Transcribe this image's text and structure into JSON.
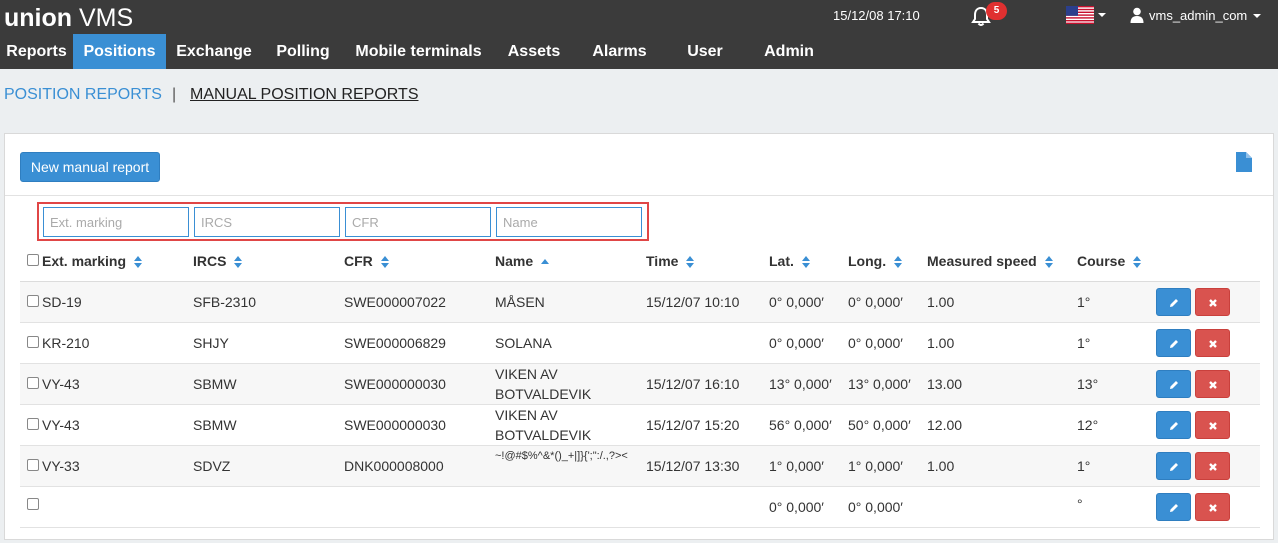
{
  "header": {
    "logo_bold": "union",
    "logo_light": "VMS",
    "datetime": "15/12/08 17:10",
    "notification_count": "5",
    "username": "vms_admin_com"
  },
  "nav": [
    {
      "label": "Reports",
      "active": false
    },
    {
      "label": "Positions",
      "active": true
    },
    {
      "label": "Exchange",
      "active": false
    },
    {
      "label": "Polling",
      "active": false
    },
    {
      "label": "Mobile terminals",
      "active": false
    },
    {
      "label": "Assets",
      "active": false
    },
    {
      "label": "Alarms",
      "active": false
    },
    {
      "label": "User",
      "active": false
    },
    {
      "label": "Admin",
      "active": false
    }
  ],
  "subnav": {
    "position_reports": "POSITION REPORTS",
    "separator": "|",
    "manual_position_reports": "MANUAL POSITION REPORTS"
  },
  "toolbar": {
    "new_report_label": "New manual report"
  },
  "filters": {
    "ext_marking_placeholder": "Ext. marking",
    "ircs_placeholder": "IRCS",
    "cfr_placeholder": "CFR",
    "name_placeholder": "Name"
  },
  "columns": {
    "ext_marking": "Ext. marking",
    "ircs": "IRCS",
    "cfr": "CFR",
    "name": "Name",
    "time": "Time",
    "lat": "Lat.",
    "long": "Long.",
    "speed": "Measured speed",
    "course": "Course"
  },
  "rows": [
    {
      "ext": "SD-19",
      "ircs": "SFB-2310",
      "cfr": "SWE000007022",
      "name": "MÅSEN",
      "time": "15/12/07 10:10",
      "lat": "0° 0,000′",
      "long": "0° 0,000′",
      "speed": "1.00",
      "course": "1°"
    },
    {
      "ext": "KR-210",
      "ircs": "SHJY",
      "cfr": "SWE000006829",
      "name": "SOLANA",
      "time": "",
      "lat": "0° 0,000′",
      "long": "0° 0,000′",
      "speed": "1.00",
      "course": "1°"
    },
    {
      "ext": "VY-43",
      "ircs": "SBMW",
      "cfr": "SWE000000030",
      "name": "VIKEN AV BOTVALDEVIK",
      "time": "15/12/07 16:10",
      "lat": "13° 0,000′",
      "long": "13° 0,000′",
      "speed": "13.00",
      "course": "13°"
    },
    {
      "ext": "VY-43",
      "ircs": "SBMW",
      "cfr": "SWE000000030",
      "name": "VIKEN AV BOTVALDEVIK",
      "time": "15/12/07 15:20",
      "lat": "56° 0,000′",
      "long": "50° 0,000′",
      "speed": "12.00",
      "course": "12°"
    },
    {
      "ext": "VY-33",
      "ircs": "SDVZ",
      "cfr": "DNK000008000",
      "name": "~!@#$%^&*()_+|]}{';\":/.,?><",
      "time": "15/12/07 13:30",
      "lat": "1° 0,000′",
      "long": "1° 0,000′",
      "speed": "1.00",
      "course": "1°"
    },
    {
      "ext": "",
      "ircs": "",
      "cfr": "",
      "name": "",
      "time": "",
      "lat": "0° 0,000′",
      "long": "0° 0,000′",
      "speed": "",
      "course": "°"
    }
  ],
  "colors": {
    "topbar": "#3b3b3b",
    "accent": "#3a8fd4",
    "danger": "#d9534f",
    "highlight_border": "#e04646"
  },
  "icons": [
    "bell-icon",
    "us-flag-icon",
    "user-icon",
    "document-icon",
    "pencil-icon",
    "times-icon",
    "sort-icon",
    "sort-asc-icon"
  ]
}
